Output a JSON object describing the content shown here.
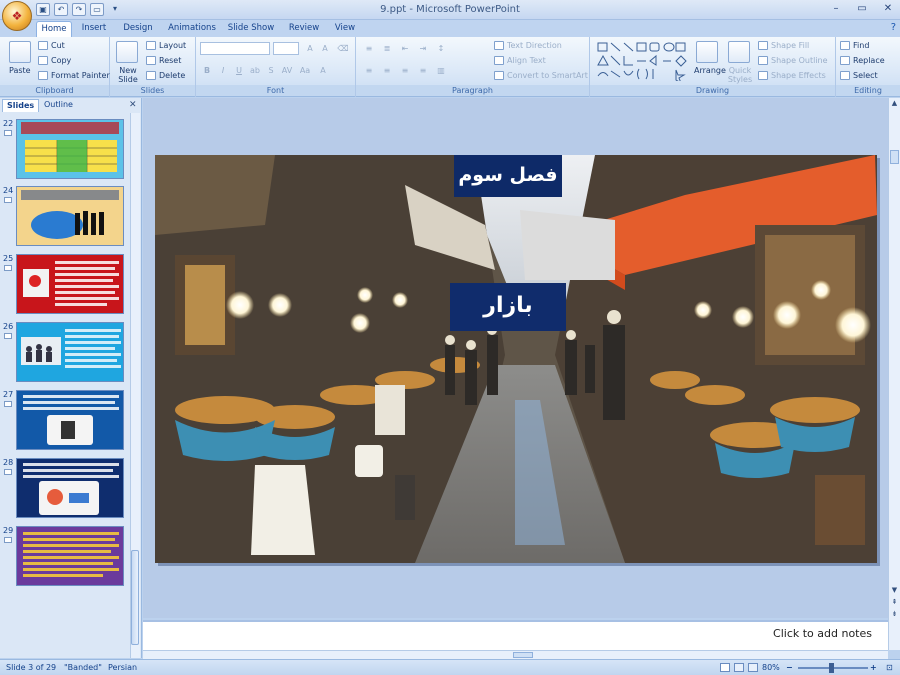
{
  "window": {
    "title": "9.ppt - Microsoft PowerPoint"
  },
  "tabs": [
    "Home",
    "Insert",
    "Design",
    "Animations",
    "Slide Show",
    "Review",
    "View"
  ],
  "ribbon": {
    "clipboard": {
      "label": "Clipboard",
      "paste": "Paste",
      "cut": "Cut",
      "copy": "Copy",
      "format_painter": "Format Painter"
    },
    "slides": {
      "label": "Slides",
      "new_slide": "New Slide",
      "layout": "Layout",
      "reset": "Reset",
      "delete": "Delete"
    },
    "font": {
      "label": "Font"
    },
    "paragraph": {
      "label": "Paragraph",
      "text_direction": "Text Direction",
      "align_text": "Align Text",
      "convert_smartart": "Convert to SmartArt"
    },
    "drawing": {
      "label": "Drawing",
      "arrange": "Arrange",
      "quick_styles": "Quick Styles",
      "shape_fill": "Shape Fill",
      "shape_outline": "Shape Outline",
      "shape_effects": "Shape Effects"
    },
    "editing": {
      "label": "Editing",
      "find": "Find",
      "replace": "Replace",
      "select": "Select"
    }
  },
  "pane": {
    "tab_slides": "Slides",
    "tab_outline": "Outline"
  },
  "thumbnails": [
    {
      "number": "22",
      "bg": "#5bc2e8"
    },
    {
      "number": "24",
      "bg": "#f3d48c"
    },
    {
      "number": "25",
      "bg": "#c8151b"
    },
    {
      "number": "26",
      "bg": "#1fa6e0"
    },
    {
      "number": "27",
      "bg": "#1259a8"
    },
    {
      "number": "28",
      "bg": "#0f2d6e"
    },
    {
      "number": "29",
      "bg": "#6a3a9c"
    }
  ],
  "slide": {
    "title": "فصل سوم",
    "subtitle": "بازار"
  },
  "notes": {
    "placeholder": "Click to add notes"
  },
  "status": {
    "slide_info": "Slide 3 of 29",
    "theme": "\"Banded\"",
    "language": "Persian",
    "zoom": "80%"
  }
}
